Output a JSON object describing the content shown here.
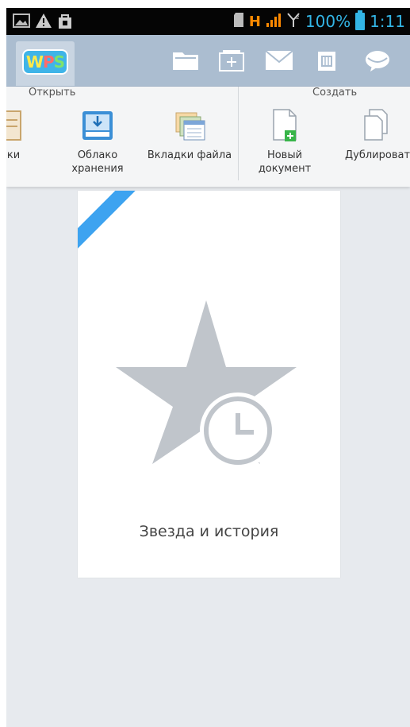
{
  "status": {
    "network": "H",
    "battery": "100%",
    "time": "1:11"
  },
  "appbar": {
    "logo_text": {
      "w": "W",
      "p": "P",
      "s": "S"
    }
  },
  "ribbon": {
    "open_group": {
      "title": "Открыть",
      "items": [
        {
          "label": "ки"
        },
        {
          "label": "Облако\nхранения"
        },
        {
          "label": "Вкладки файла"
        }
      ]
    },
    "create_group": {
      "title": "Создать",
      "items": [
        {
          "label": "Новый\nдокумент"
        },
        {
          "label": "Дублироват"
        }
      ]
    }
  },
  "card": {
    "label": "Звезда и история"
  },
  "colors": {
    "accent": "#33b5e5",
    "appbar": "#abbdd0",
    "corner_ribbon": "#3da3f0"
  }
}
